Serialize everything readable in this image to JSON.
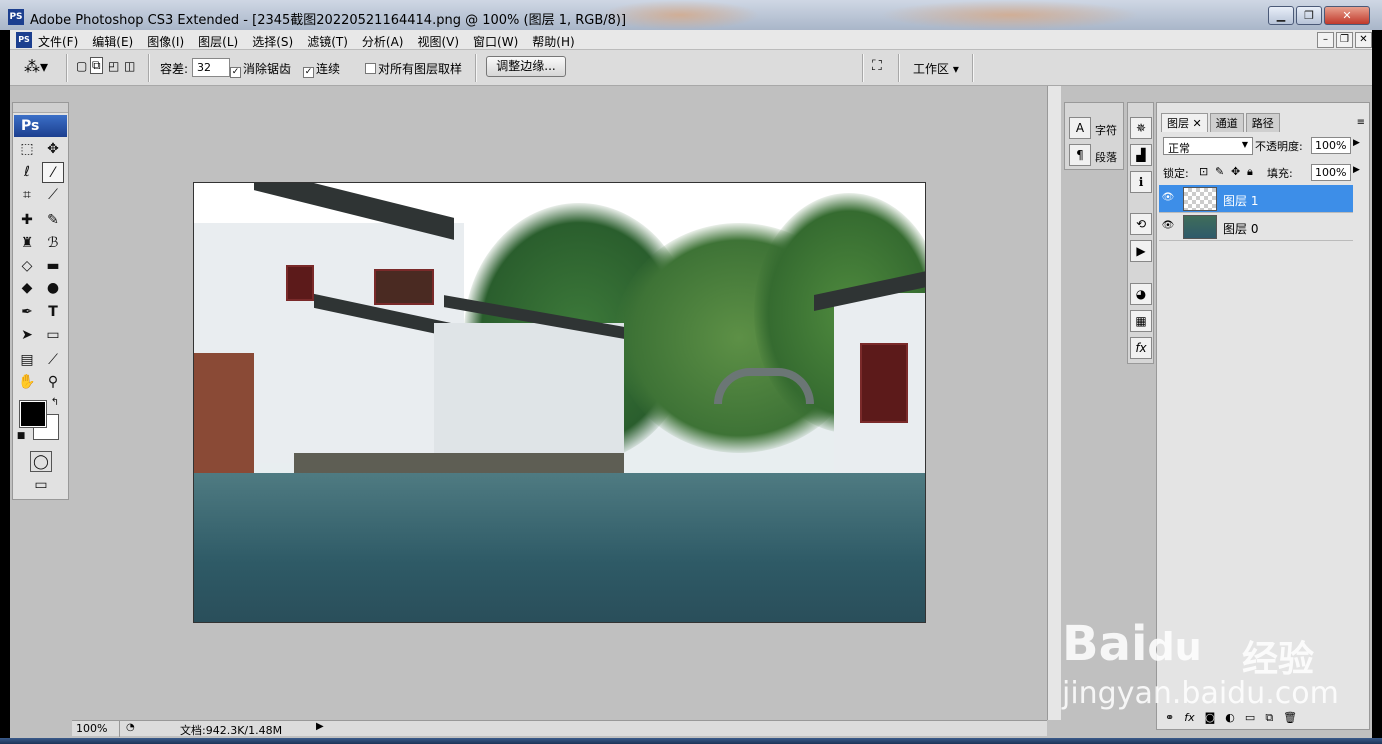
{
  "window": {
    "title": "Adobe Photoshop CS3 Extended - [2345截图20220521164414.png @ 100% (图层 1, RGB/8)]",
    "app_icon": "PS",
    "controls": [
      "minimize-icon",
      "restore-icon",
      "close-icon"
    ]
  },
  "menubar": {
    "items": [
      "文件(F)",
      "编辑(E)",
      "图像(I)",
      "图层(L)",
      "选择(S)",
      "滤镜(T)",
      "分析(A)",
      "视图(V)",
      "窗口(W)",
      "帮助(H)"
    ]
  },
  "options": {
    "tolerance_label": "容差:",
    "tolerance_value": "32",
    "anti_alias_label": "消除锯齿",
    "anti_alias_checked": true,
    "contiguous_label": "连续",
    "contiguous_checked": true,
    "sample_all_label": "对所有图层取样",
    "sample_all_checked": false,
    "refine_edge_label": "调整边缘...",
    "workspace_label": "工作区 ▾"
  },
  "toolbox": {
    "logo": "Ps",
    "tools": [
      "marquee-icon",
      "move-icon",
      "lasso-icon",
      "magic-wand-icon",
      "crop-icon",
      "eyedropper-icon",
      "healing-brush-icon",
      "brush-icon",
      "clone-stamp-icon",
      "history-brush-icon",
      "eraser-icon",
      "gradient-icon",
      "blur-icon",
      "dodge-icon",
      "pen-icon",
      "type-icon",
      "path-select-icon",
      "shape-icon",
      "notes-icon",
      "eyedropper2-icon",
      "hand-icon",
      "zoom-icon"
    ],
    "type_tool_glyph": "T",
    "foreground_color": "#000000",
    "background_color": "#ffffff"
  },
  "status": {
    "zoom": "100%",
    "doc_info": "文档:942.3K/1.48M"
  },
  "char_panel": {
    "character_label": "字符",
    "paragraph_label": "段落"
  },
  "layers_panel": {
    "tabs": [
      "图层",
      "通道",
      "路径"
    ],
    "blend_mode": "正常",
    "opacity_label": "不透明度:",
    "opacity_value": "100%",
    "lock_label": "锁定:",
    "fill_label": "填充:",
    "fill_value": "100%",
    "layers": [
      {
        "name": "图层 1",
        "selected": true
      },
      {
        "name": "图层 0",
        "selected": false
      }
    ],
    "bottom_icons": [
      "link-icon",
      "fx-icon",
      "mask-icon",
      "adjustment-icon",
      "group-icon",
      "new-layer-icon",
      "delete-icon"
    ]
  },
  "watermark": {
    "brand": "Bai",
    "brand2": "du",
    "cn": "经验",
    "url": "jingyan.baidu.com"
  },
  "colors": {
    "accent_selected": "#3d8ee8",
    "titlebar": "#a9b6c9",
    "workspace": "#c0c0c0"
  }
}
